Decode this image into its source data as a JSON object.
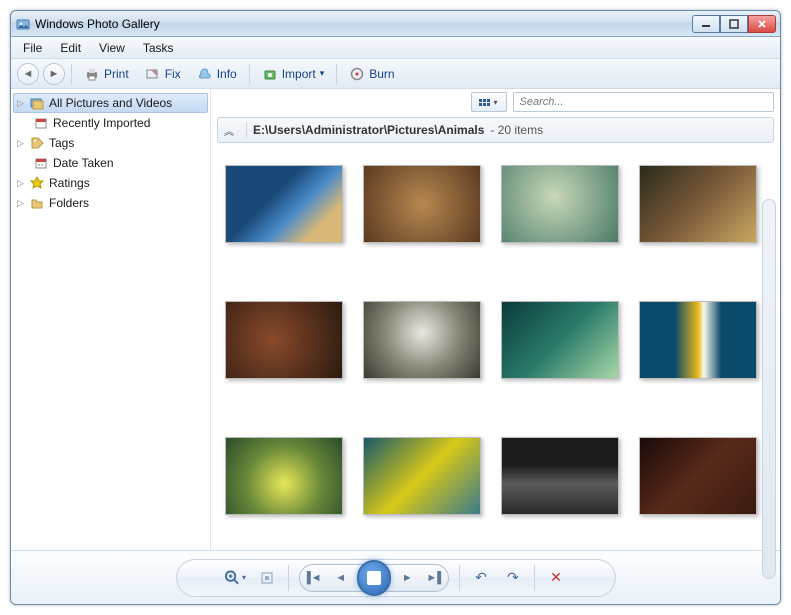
{
  "window": {
    "title": "Windows Photo Gallery"
  },
  "menubar": {
    "file": "File",
    "edit": "Edit",
    "view": "View",
    "tasks": "Tasks"
  },
  "toolbar": {
    "print": "Print",
    "fix": "Fix",
    "info": "Info",
    "import": "Import",
    "burn": "Burn"
  },
  "sidebar": {
    "allPictures": "All Pictures and Videos",
    "recentlyImported": "Recently Imported",
    "tags": "Tags",
    "dateTaken": "Date Taken",
    "ratings": "Ratings",
    "folders": "Folders"
  },
  "search": {
    "placeholder": "Search..."
  },
  "breadcrumb": {
    "path": "E:\\Users\\Administrator\\Pictures\\Animals",
    "itemCount": "- 20 items"
  },
  "thumbnails": {
    "count": 12
  },
  "icons": {
    "back": "◄",
    "forward": "►",
    "dropdown": "▾",
    "expand": "▷",
    "collapse": "≫",
    "prev": "⏮",
    "next": "⏭",
    "prevsm": "◄",
    "nextsm": "►",
    "undo": "↶",
    "redo": "↷",
    "delete": "✕",
    "zoom": "🔍",
    "fit": "⊞"
  }
}
